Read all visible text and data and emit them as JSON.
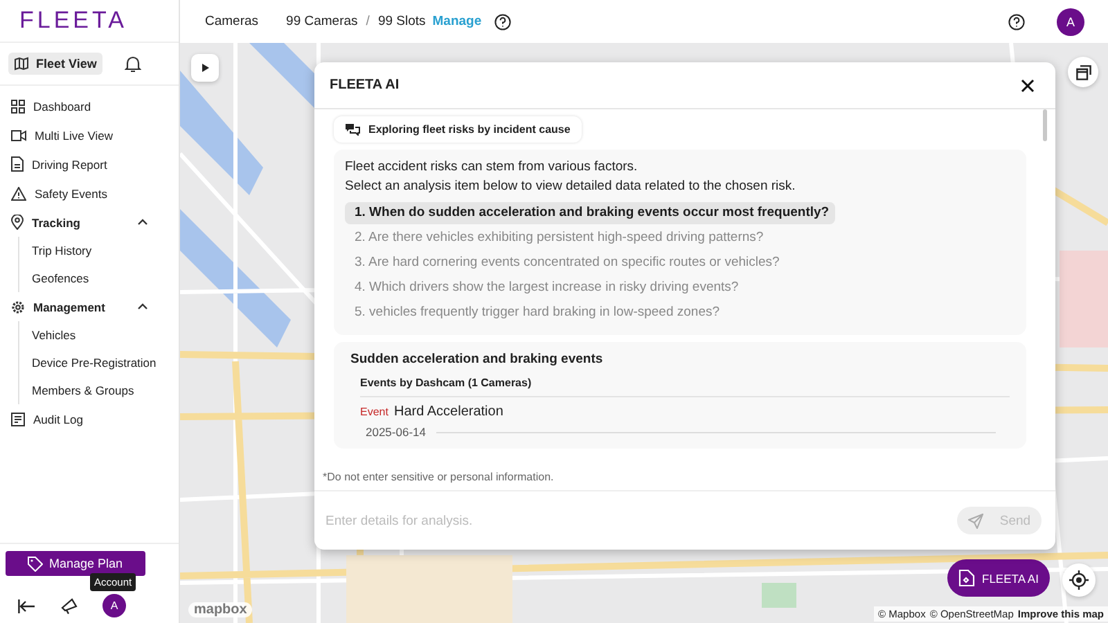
{
  "logo": "FLEETA",
  "topbar": {
    "label": "Cameras",
    "cameras": "99 Cameras",
    "separator": "/",
    "slots": "99 Slots",
    "manage_link": "Manage",
    "avatar": "A"
  },
  "sidebar": {
    "fleet_view": {
      "label": "Fleet View",
      "selected": true
    },
    "items": [
      {
        "kind": "link",
        "label": "Dashboard"
      },
      {
        "kind": "link",
        "label": "Multi Live View"
      },
      {
        "kind": "link",
        "label": "Driving Report"
      },
      {
        "kind": "link",
        "label": "Safety Events"
      },
      {
        "kind": "group",
        "label": "Tracking",
        "expanded": true,
        "children": [
          {
            "label": "Trip History"
          },
          {
            "label": "Geofences"
          }
        ]
      },
      {
        "kind": "group",
        "label": "Management",
        "expanded": true,
        "children": [
          {
            "label": "Vehicles"
          },
          {
            "label": "Device Pre-Registration"
          },
          {
            "label": "Members & Groups"
          }
        ]
      },
      {
        "kind": "link",
        "label": "Audit Log"
      }
    ],
    "manage_plan": "Manage Plan",
    "tooltip": "Account",
    "avatar": "A"
  },
  "assistant": {
    "title": "FLEETA AI",
    "topic_chip": "Exploring fleet risks by incident cause",
    "intro": [
      "Fleet accident risks can stem from various factors.",
      "Select an analysis item below to view detailed data related to the chosen risk."
    ],
    "questions": [
      {
        "text": "1. When do sudden acceleration and braking events occur most frequently?",
        "selected": true
      },
      {
        "text": "2. Are there vehicles exhibiting persistent high-speed driving patterns?",
        "selected": false
      },
      {
        "text": "3. Are hard cornering events concentrated on specific routes or vehicles?",
        "selected": false
      },
      {
        "text": "4. Which drivers show the largest increase in risky driving events?",
        "selected": false
      },
      {
        "text": "5.  vehicles frequently trigger hard braking in low-speed zones?",
        "selected": false
      }
    ],
    "result": {
      "title": "Sudden acceleration and braking events",
      "subtitle": "Events by Dashcam (1 Cameras)",
      "event_tag": "Event",
      "event_name": "Hard Acceleration",
      "date": "2025-06-14"
    },
    "disclaimer": "*Do not enter sensitive or personal information.",
    "input": {
      "placeholder": "Enter details for analysis."
    },
    "send": {
      "label": "Send",
      "disabled": true
    }
  },
  "map": {
    "fab": "FLEETA AI",
    "logo": "mapbox",
    "attribution": [
      "© Mapbox",
      "© OpenStreetMap"
    ],
    "improve_link": "Improve this map"
  }
}
